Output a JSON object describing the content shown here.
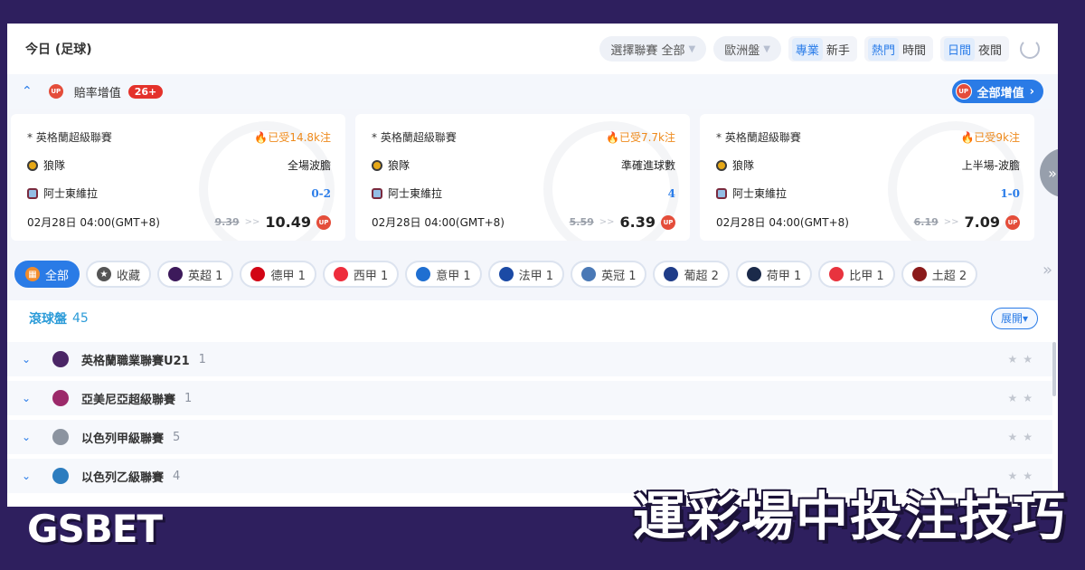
{
  "header": {
    "title": "今日 (足球)",
    "league_select": "選擇聯賽 全部",
    "odds_type": "歐洲盤",
    "mode_toggle": [
      "專業",
      "新手"
    ],
    "sort_toggle": [
      "熱門",
      "時間"
    ],
    "theme_toggle": [
      "日間",
      "夜間"
    ]
  },
  "odds_bar": {
    "badge": "UP",
    "label": "賠率增值",
    "count": "26+",
    "all_button": "全部增值"
  },
  "cards": [
    {
      "league": "* 英格蘭超級聯賽",
      "hot": "已受14.8k注",
      "team1": "狼隊",
      "team2": "阿士東維拉",
      "market": "全場波膽",
      "pick": "0-2",
      "date": "02月28日 04:00(GMT+8)",
      "old_odds": "9.39",
      "new_odds": "10.49"
    },
    {
      "league": "* 英格蘭超級聯賽",
      "hot": "已受7.7k注",
      "team1": "狼隊",
      "team2": "阿士東維拉",
      "market": "準確進球數",
      "pick": "4",
      "date": "02月28日 04:00(GMT+8)",
      "old_odds": "5.59",
      "new_odds": "6.39"
    },
    {
      "league": "* 英格蘭超級聯賽",
      "hot": "已受9k注",
      "team1": "狼隊",
      "team2": "阿士東維拉",
      "market": "上半場-波膽",
      "pick": "1-0",
      "date": "02月28日 04:00(GMT+8)",
      "old_odds": "6.19",
      "new_odds": "7.09"
    }
  ],
  "chips": [
    {
      "label": "全部",
      "icon": "grid-icon",
      "color": "#f28c2b"
    },
    {
      "label": "收藏",
      "icon": "star-icon",
      "color": "#555555"
    },
    {
      "label": "英超 1",
      "icon": "premier-league-icon",
      "color": "#3d1a5b"
    },
    {
      "label": "德甲 1",
      "icon": "bundesliga-icon",
      "color": "#d20515"
    },
    {
      "label": "西甲 1",
      "icon": "laliga-icon",
      "color": "#ee2d3c"
    },
    {
      "label": "意甲 1",
      "icon": "serie-a-icon",
      "color": "#1f6fd1"
    },
    {
      "label": "法甲 1",
      "icon": "ligue1-icon",
      "color": "#1b4aa5"
    },
    {
      "label": "英冠 1",
      "icon": "championship-icon",
      "color": "#4a79b6"
    },
    {
      "label": "葡超 2",
      "icon": "liga-portugal-icon",
      "color": "#1f3c88"
    },
    {
      "label": "荷甲 1",
      "icon": "eredivisie-icon",
      "color": "#1b2a4a"
    },
    {
      "label": "比甲 1",
      "icon": "pro-league-icon",
      "color": "#e8333e"
    },
    {
      "label": "土超 2",
      "icon": "super-lig-icon",
      "color": "#8b1a1a"
    }
  ],
  "inplay": {
    "title": "滾球盤",
    "count": "45",
    "expand": "展開▾",
    "leagues": [
      {
        "name": "英格蘭職業聯賽U21",
        "count": "1",
        "color": "#4b2666"
      },
      {
        "name": "亞美尼亞超級聯賽",
        "count": "1",
        "color": "#9c2a6a"
      },
      {
        "name": "以色列甲級聯賽",
        "count": "5",
        "color": "#8c94a0"
      },
      {
        "name": "以色列乙級聯賽",
        "count": "4",
        "color": "#2d7dbf"
      }
    ]
  },
  "brand": {
    "logo": "GSBET",
    "banner": "運彩場中投注技巧"
  }
}
